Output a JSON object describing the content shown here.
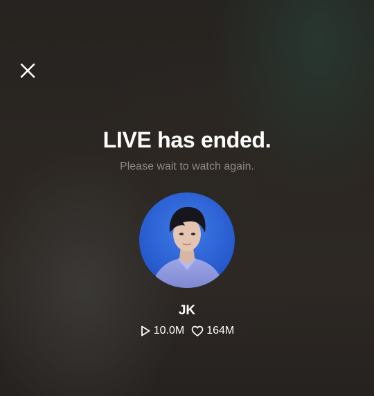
{
  "screen": {
    "title": "LIVE has ended.",
    "subtitle": "Please wait to watch again."
  },
  "controls": {
    "close_icon": "close-icon"
  },
  "creator": {
    "name": "JK",
    "avatar_icon": "avatar",
    "views": "10.0M",
    "views_icon": "play-icon",
    "likes": "164M",
    "likes_icon": "heart-icon"
  },
  "colors": {
    "background": "#2a2622",
    "subtitle": "#8c8884",
    "avatar_background": "#2a5fd6",
    "text": "#ffffff"
  }
}
